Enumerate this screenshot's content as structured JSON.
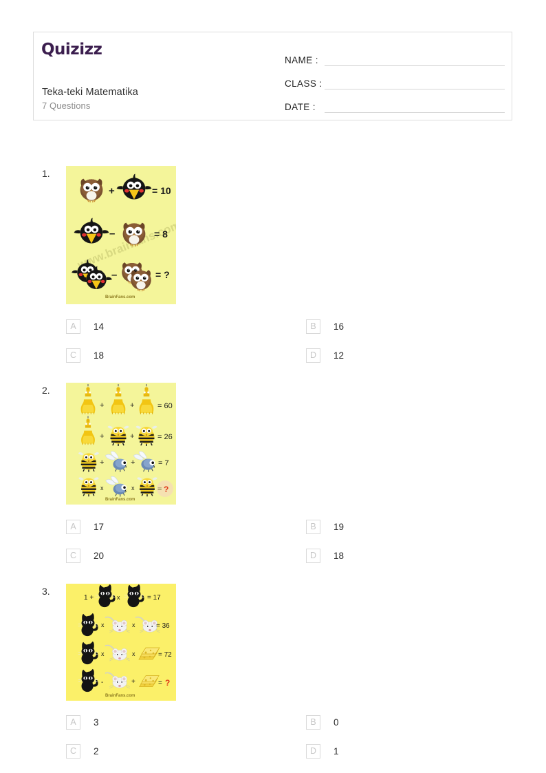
{
  "header": {
    "brand": "Quizizz",
    "quiz_title": "Teka-teki Matematika",
    "question_count_label": "7 Questions",
    "fields": [
      {
        "label": "NAME :",
        "value": ""
      },
      {
        "label": "CLASS :",
        "value": ""
      },
      {
        "label": "DATE  :",
        "value": ""
      }
    ]
  },
  "brand_color": "#3b1e4e",
  "puzzle_bg_color": "#f4f59a",
  "questions": [
    {
      "number": "1.",
      "image": {
        "name": "owl-crow-math-puzzle",
        "watermark": "www.brainfans.com",
        "footer": "BrainFans.com",
        "rows": [
          {
            "terms": [
              "owl",
              "crow"
            ],
            "operators": [
              "+"
            ],
            "result": "= 10"
          },
          {
            "terms": [
              "crow",
              "owl"
            ],
            "operators": [
              "–"
            ],
            "result": "= 8"
          },
          {
            "terms": [
              "crow-double",
              "owl-double"
            ],
            "operators": [
              "–"
            ],
            "result": "= ?"
          }
        ]
      },
      "options": [
        {
          "letter": "A",
          "text": "14"
        },
        {
          "letter": "B",
          "text": "16"
        },
        {
          "letter": "C",
          "text": "18"
        },
        {
          "letter": "D",
          "text": "12"
        }
      ]
    },
    {
      "number": "2.",
      "image": {
        "name": "bee-fly-jar-math-puzzle",
        "footer": "BrainFans.com",
        "rows": [
          {
            "terms": [
              "jar",
              "jar",
              "jar"
            ],
            "operators": [
              "+",
              "+"
            ],
            "result": "= 60"
          },
          {
            "terms": [
              "jar",
              "bee",
              "bee"
            ],
            "operators": [
              "+",
              "+"
            ],
            "result": "= 26"
          },
          {
            "terms": [
              "bee",
              "fly",
              "fly"
            ],
            "operators": [
              "+",
              "+"
            ],
            "result": "= 7"
          },
          {
            "terms": [
              "bee",
              "fly",
              "bee"
            ],
            "operators": [
              "x",
              "x"
            ],
            "result": "= ?"
          }
        ]
      },
      "options": [
        {
          "letter": "A",
          "text": "17"
        },
        {
          "letter": "B",
          "text": "19"
        },
        {
          "letter": "C",
          "text": "20"
        },
        {
          "letter": "D",
          "text": "18"
        }
      ]
    },
    {
      "number": "3.",
      "image": {
        "name": "cat-mouse-cheese-math-puzzle",
        "footer": "BrainFans.com",
        "rows": [
          {
            "terms": [
              "1",
              "cat",
              "cat"
            ],
            "operators": [
              "+",
              "x"
            ],
            "result": "= 17"
          },
          {
            "terms": [
              "cat",
              "mouse",
              "mouse"
            ],
            "operators": [
              "x",
              "x"
            ],
            "result": "= 36"
          },
          {
            "terms": [
              "cat",
              "mouse",
              "cheese"
            ],
            "operators": [
              "x",
              "x"
            ],
            "result": "= 72"
          },
          {
            "terms": [
              "cat",
              "mouse",
              "cheese"
            ],
            "operators": [
              "-",
              "+"
            ],
            "result": "= ?"
          }
        ]
      },
      "options": [
        {
          "letter": "A",
          "text": "3"
        },
        {
          "letter": "B",
          "text": "0"
        },
        {
          "letter": "C",
          "text": "2"
        },
        {
          "letter": "D",
          "text": "1"
        }
      ]
    }
  ]
}
